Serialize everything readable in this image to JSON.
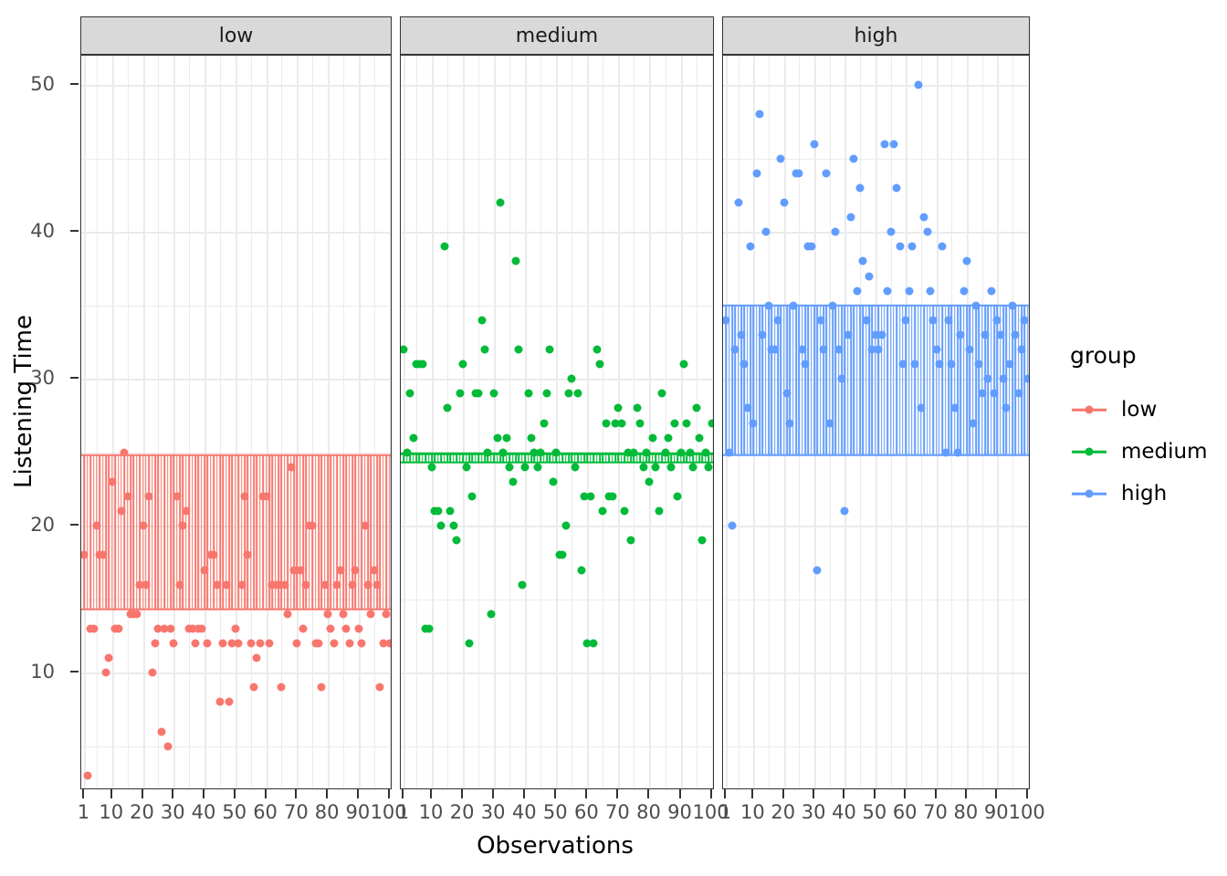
{
  "chart_data": {
    "type": "scatter",
    "title": "",
    "xlabel": "Observations",
    "ylabel": "Listening Time",
    "xlim": [
      0,
      101
    ],
    "ylim": [
      2,
      52
    ],
    "grid": true,
    "legend_position": "right",
    "legend_title": "group",
    "facet_labels": [
      "low",
      "medium",
      "high"
    ],
    "x_ticks": [
      "1",
      "10",
      "20",
      "30",
      "40",
      "50",
      "60",
      "70",
      "80",
      "90",
      "100"
    ],
    "x_tick_values": [
      1,
      10,
      20,
      30,
      40,
      50,
      60,
      70,
      80,
      90,
      100
    ],
    "y_ticks": [
      "10",
      "20",
      "30",
      "40",
      "50"
    ],
    "y_tick_values": [
      10,
      20,
      30,
      40,
      50
    ],
    "colors": {
      "low": "#F8766D",
      "medium": "#00BA38",
      "high": "#619CFF"
    },
    "reference_lines": {
      "low": {
        "upper": 24.8,
        "lower": 14.3
      },
      "medium": {
        "upper": 24.9,
        "lower": 24.3
      },
      "high": {
        "upper": 35.0,
        "lower": 24.8
      }
    },
    "series": [
      {
        "name": "low",
        "color": "#F8766D",
        "x": [
          1,
          2,
          3,
          4,
          5,
          6,
          7,
          8,
          9,
          10,
          11,
          12,
          13,
          14,
          15,
          16,
          17,
          18,
          19,
          20,
          21,
          22,
          23,
          24,
          25,
          26,
          27,
          28,
          29,
          30,
          31,
          32,
          33,
          34,
          35,
          36,
          37,
          38,
          39,
          40,
          41,
          42,
          43,
          44,
          45,
          46,
          47,
          48,
          49,
          50,
          51,
          52,
          53,
          54,
          55,
          56,
          57,
          58,
          59,
          60,
          61,
          62,
          63,
          64,
          65,
          66,
          67,
          68,
          69,
          70,
          71,
          72,
          73,
          74,
          75,
          76,
          77,
          78,
          79,
          80,
          81,
          82,
          83,
          84,
          85,
          86,
          87,
          88,
          89,
          90,
          91,
          92,
          93,
          94,
          95,
          96,
          97,
          98,
          99,
          100
        ],
        "y": [
          18,
          3,
          13,
          13,
          20,
          18,
          18,
          10,
          11,
          23,
          13,
          13,
          21,
          25,
          22,
          14,
          14,
          14,
          16,
          20,
          16,
          22,
          10,
          12,
          13,
          6,
          13,
          5,
          13,
          12,
          22,
          16,
          20,
          21,
          13,
          13,
          12,
          13,
          13,
          17,
          12,
          18,
          18,
          16,
          8,
          12,
          16,
          8,
          12,
          13,
          12,
          16,
          22,
          18,
          12,
          9,
          11,
          12,
          22,
          22,
          12,
          16,
          16,
          16,
          9,
          16,
          14,
          24,
          17,
          12,
          17,
          13,
          16,
          20,
          20,
          12,
          12,
          9,
          16,
          14,
          13,
          12,
          16,
          17,
          14,
          13,
          12,
          16,
          17,
          13,
          12,
          20,
          16,
          14,
          17,
          16,
          9,
          12,
          14,
          12
        ]
      },
      {
        "name": "medium",
        "color": "#00BA38",
        "x": [
          1,
          2,
          3,
          4,
          5,
          6,
          7,
          8,
          9,
          10,
          11,
          12,
          13,
          14,
          15,
          16,
          17,
          18,
          19,
          20,
          21,
          22,
          23,
          24,
          25,
          26,
          27,
          28,
          29,
          30,
          31,
          32,
          33,
          34,
          35,
          36,
          37,
          38,
          39,
          40,
          41,
          42,
          43,
          44,
          45,
          46,
          47,
          48,
          49,
          50,
          51,
          52,
          53,
          54,
          55,
          56,
          57,
          58,
          59,
          60,
          61,
          62,
          63,
          64,
          65,
          66,
          67,
          68,
          69,
          70,
          71,
          72,
          73,
          74,
          75,
          76,
          77,
          78,
          79,
          80,
          81,
          82,
          83,
          84,
          85,
          86,
          87,
          88,
          89,
          90,
          91,
          92,
          93,
          94,
          95,
          96,
          97,
          98,
          99,
          100
        ],
        "y": [
          32,
          25,
          29,
          26,
          31,
          31,
          31,
          13,
          13,
          24,
          21,
          21,
          20,
          39,
          28,
          21,
          20,
          19,
          29,
          31,
          24,
          12,
          22,
          29,
          29,
          34,
          32,
          25,
          14,
          29,
          26,
          42,
          25,
          26,
          24,
          23,
          38,
          32,
          16,
          24,
          29,
          26,
          25,
          24,
          25,
          27,
          29,
          32,
          23,
          25,
          18,
          18,
          20,
          29,
          30,
          24,
          29,
          17,
          22,
          12,
          22,
          12,
          32,
          31,
          21,
          27,
          22,
          22,
          27,
          28,
          27,
          21,
          25,
          19,
          25,
          28,
          27,
          24,
          25,
          23,
          26,
          24,
          21,
          29,
          25,
          26,
          24,
          27,
          22,
          25,
          31,
          27,
          25,
          24,
          28,
          26,
          19,
          25,
          24,
          27
        ]
      },
      {
        "name": "high",
        "color": "#619CFF",
        "x": [
          1,
          2,
          3,
          4,
          5,
          6,
          7,
          8,
          9,
          10,
          11,
          12,
          13,
          14,
          15,
          16,
          17,
          18,
          19,
          20,
          21,
          22,
          23,
          24,
          25,
          26,
          27,
          28,
          29,
          30,
          31,
          32,
          33,
          34,
          35,
          36,
          37,
          38,
          39,
          40,
          41,
          42,
          43,
          44,
          45,
          46,
          47,
          48,
          49,
          50,
          51,
          52,
          53,
          54,
          55,
          56,
          57,
          58,
          59,
          60,
          61,
          62,
          63,
          64,
          65,
          66,
          67,
          68,
          69,
          70,
          71,
          72,
          73,
          74,
          75,
          76,
          77,
          78,
          79,
          80,
          81,
          82,
          83,
          84,
          85,
          86,
          87,
          88,
          89,
          90,
          91,
          92,
          93,
          94,
          95,
          96,
          97,
          98,
          99,
          100
        ],
        "y": [
          34,
          25,
          20,
          32,
          42,
          33,
          31,
          28,
          39,
          27,
          44,
          48,
          33,
          40,
          35,
          32,
          32,
          34,
          45,
          42,
          29,
          27,
          35,
          44,
          44,
          32,
          31,
          39,
          39,
          46,
          17,
          34,
          32,
          44,
          27,
          35,
          40,
          32,
          30,
          21,
          33,
          41,
          45,
          36,
          43,
          38,
          34,
          37,
          32,
          33,
          32,
          33,
          46,
          36,
          40,
          46,
          43,
          39,
          31,
          34,
          36,
          39,
          31,
          50,
          28,
          41,
          40,
          36,
          34,
          32,
          31,
          39,
          25,
          34,
          31,
          28,
          25,
          33,
          36,
          38,
          32,
          27,
          35,
          31,
          29,
          33,
          30,
          36,
          29,
          34,
          33,
          30,
          28,
          31,
          35,
          33,
          29,
          32,
          34,
          30
        ]
      }
    ]
  },
  "axes": {
    "y_title": "Listening Time",
    "x_title": "Observations"
  },
  "legend": {
    "title": "group",
    "items": [
      {
        "label": "low",
        "color": "#F8766D"
      },
      {
        "label": "medium",
        "color": "#00BA38"
      },
      {
        "label": "high",
        "color": "#619CFF"
      }
    ]
  },
  "facets": [
    {
      "label": "low"
    },
    {
      "label": "medium"
    },
    {
      "label": "high"
    }
  ]
}
